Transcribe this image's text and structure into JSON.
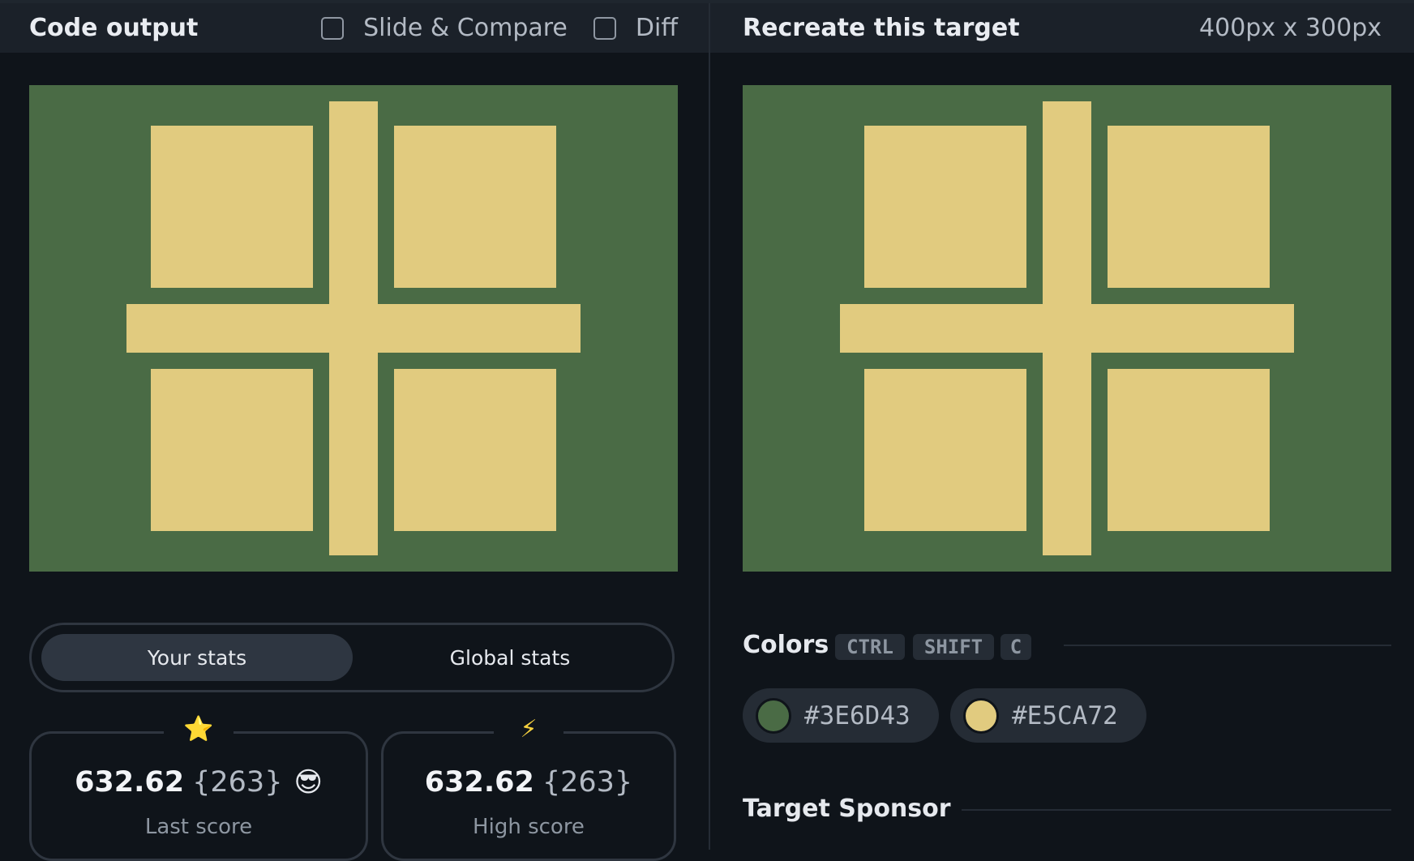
{
  "left_panel": {
    "title": "Code output",
    "options": [
      {
        "label": "Slide & Compare",
        "checked": false
      },
      {
        "label": "Diff",
        "checked": false
      }
    ]
  },
  "right_panel": {
    "title": "Recreate this target",
    "dimensions": "400px x 300px"
  },
  "canvas_colors": {
    "background": "#3E6D43",
    "foreground": "#E5CA72"
  },
  "stats": {
    "tabs": [
      {
        "label": "Your stats",
        "active": true
      },
      {
        "label": "Global stats",
        "active": false
      }
    ],
    "last": {
      "icon": "star-icon",
      "glyph": "⭐",
      "score": "632.62",
      "count": "{263}",
      "emoji": "😎",
      "label": "Last score"
    },
    "high": {
      "icon": "lightning-icon",
      "glyph": "⚡",
      "score": "632.62",
      "count": "{263}",
      "label": "High score"
    }
  },
  "colors": {
    "title": "Colors",
    "shortcut": [
      "CTRL",
      "SHIFT",
      "C"
    ],
    "swatches": [
      "#3E6D43",
      "#E5CA72"
    ]
  },
  "sponsor": {
    "title": "Target Sponsor"
  }
}
